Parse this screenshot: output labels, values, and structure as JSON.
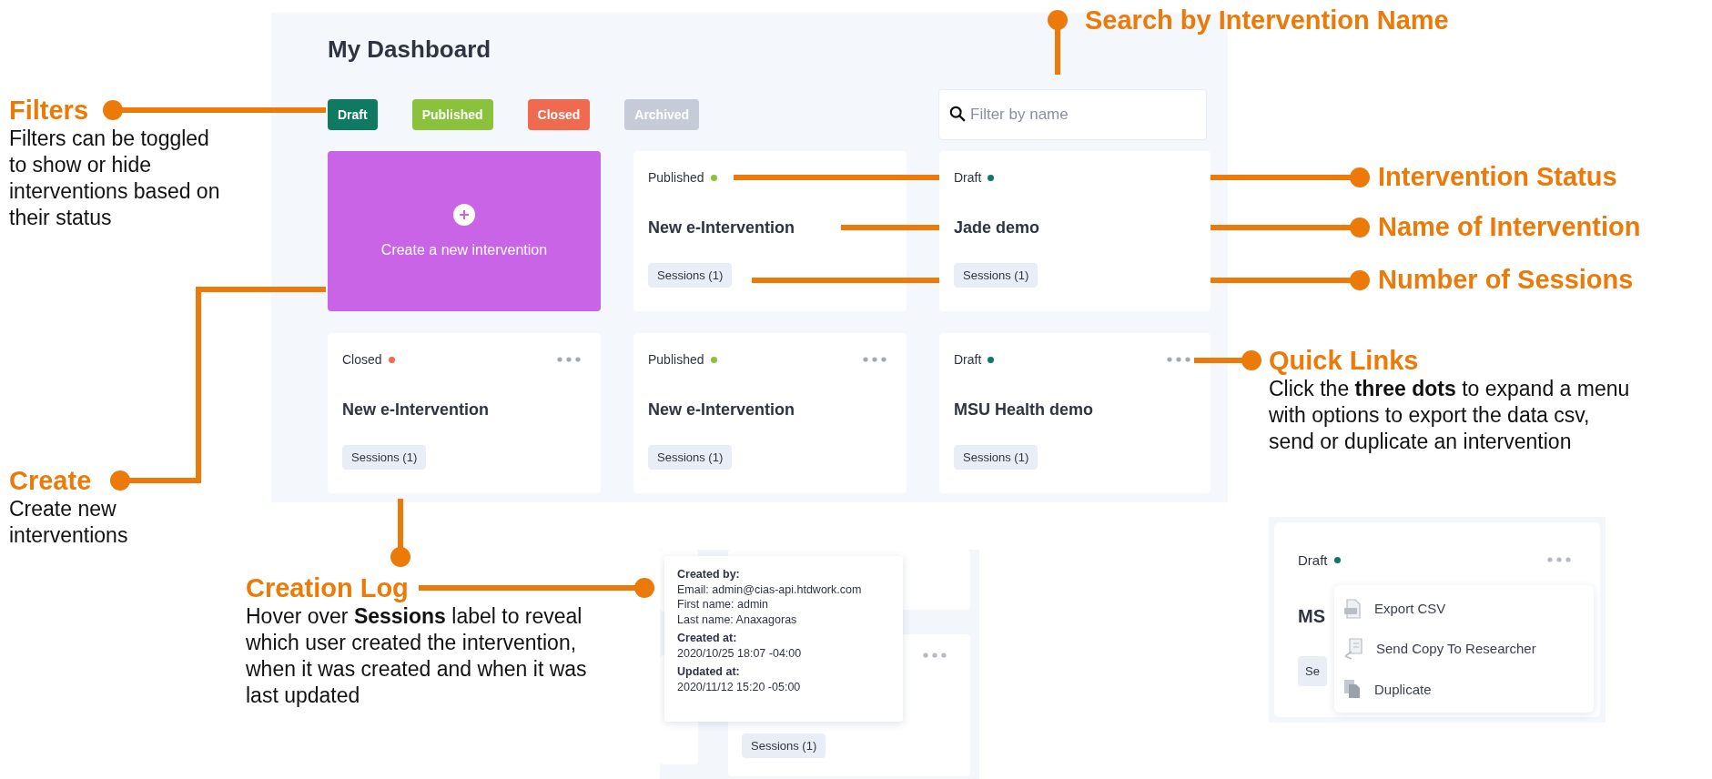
{
  "dashboard": {
    "title": "My Dashboard",
    "filters": [
      {
        "label": "Draft",
        "color": "#0f7a62"
      },
      {
        "label": "Published",
        "color": "#8ac33b"
      },
      {
        "label": "Closed",
        "color": "#ef6a4f"
      },
      {
        "label": "Archived",
        "color": "#c5ccd8"
      }
    ],
    "search": {
      "placeholder": "Filter by name"
    },
    "create_tile": {
      "label": "Create a new intervention"
    },
    "cards": [
      {
        "status": "Published",
        "color": "#8ac33b",
        "name": "New e-Intervention",
        "sessions": "Sessions (1)",
        "menu_dots": false
      },
      {
        "status": "Draft",
        "color": "#0f7a62",
        "name": "Jade demo",
        "sessions": "Sessions (1)",
        "menu_dots": false
      },
      {
        "status": "Closed",
        "color": "#ef6a4f",
        "name": "New e-Intervention",
        "sessions": "Sessions (1)",
        "menu_dots": true
      },
      {
        "status": "Published",
        "color": "#8ac33b",
        "name": "New e-Intervention",
        "sessions": "Sessions (1)",
        "menu_dots": true
      },
      {
        "status": "Draft",
        "color": "#0f7a62",
        "name": "MSU Health demo",
        "sessions": "Sessions (1)",
        "menu_dots": true
      }
    ]
  },
  "callouts": [
    {
      "title": "Filters",
      "description": "Filters can be toggled to show or hide interventions based on their status"
    },
    {
      "title": "Create",
      "description": "Create new interventions"
    },
    {
      "title": "Creation Log",
      "description": "Hover over **Sessions** label to reveal which user created the intervention, when it was created and when it was last updated"
    },
    {
      "title": "Search by Intervention Name"
    },
    {
      "title": "Intervention Status"
    },
    {
      "title": "Name of Intervention"
    },
    {
      "title": "Number of Sessions"
    },
    {
      "title": "Quick Links",
      "description": "Click the **three dots** to expand a menu with options to export the data csv, send or duplicate an intervention"
    }
  ],
  "creation_log_inset": {
    "sessions": "Sessions (1)",
    "tooltip": [
      {
        "heading": "Created by:",
        "lines": [
          "Email: admin@cias-api.htdwork.com",
          "First name: admin",
          "Last name: Anaxagoras"
        ]
      },
      {
        "heading": "Created at:",
        "lines": [
          "2020/10/25 18:07 -04:00"
        ]
      },
      {
        "heading": "Updated at:",
        "lines": [
          "2020/11/12 15:20 -05:00"
        ]
      }
    ]
  },
  "quick_links_inset": {
    "status": "Draft",
    "color": "#0f7a62",
    "name": "MS",
    "sessions": "Se",
    "menu": [
      {
        "kind": "csv",
        "label": "Export CSV"
      },
      {
        "kind": "send",
        "label": "Send Copy To Researcher"
      },
      {
        "kind": "copy",
        "label": "Duplicate"
      }
    ]
  }
}
